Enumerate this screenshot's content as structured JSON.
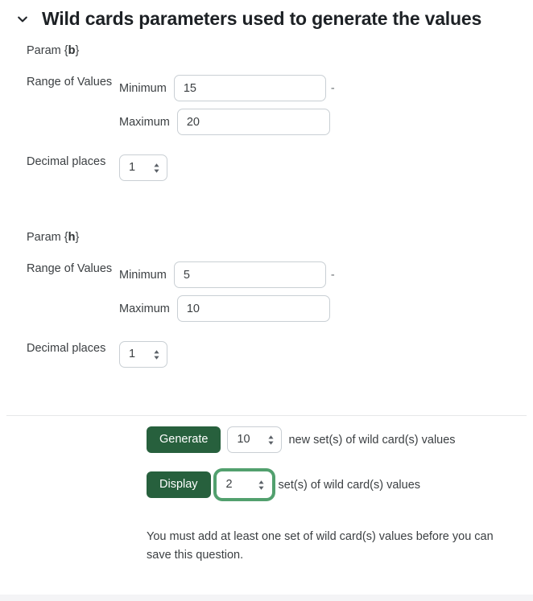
{
  "header": {
    "title": "Wild cards parameters used to generate the values",
    "collapse_icon": "chevron-down-icon",
    "expanded": true
  },
  "labels": {
    "range_of_values": "Range of Values",
    "minimum": "Minimum",
    "maximum": "Maximum",
    "decimal_places": "Decimal places",
    "range_separator": "-"
  },
  "params": [
    {
      "name": "Param {b}",
      "name_prefix": "Param {",
      "symbol": "b",
      "name_suffix": "}",
      "minimum": "15",
      "maximum": "20",
      "decimal_places": "1"
    },
    {
      "name": "Param {h}",
      "name_prefix": "Param {",
      "symbol": "h",
      "name_suffix": "}",
      "minimum": "5",
      "maximum": "10",
      "decimal_places": "1"
    }
  ],
  "actions": {
    "generate": {
      "button_label": "Generate",
      "count": "10",
      "trailing_text": "new set(s) of wild card(s) values",
      "focused": false
    },
    "display": {
      "button_label": "Display",
      "count": "2",
      "trailing_text": "set(s) of wild card(s) values",
      "focused": true
    }
  },
  "warning": {
    "text": "You must add at least one set of wild card(s) values before you can save this question."
  },
  "colors": {
    "button_green": "#27603d",
    "focus_ring_green": "#52a06e",
    "border_gray": "#c9cfd4",
    "text_dark": "#3b3f42",
    "title_dark": "#1d2125"
  }
}
